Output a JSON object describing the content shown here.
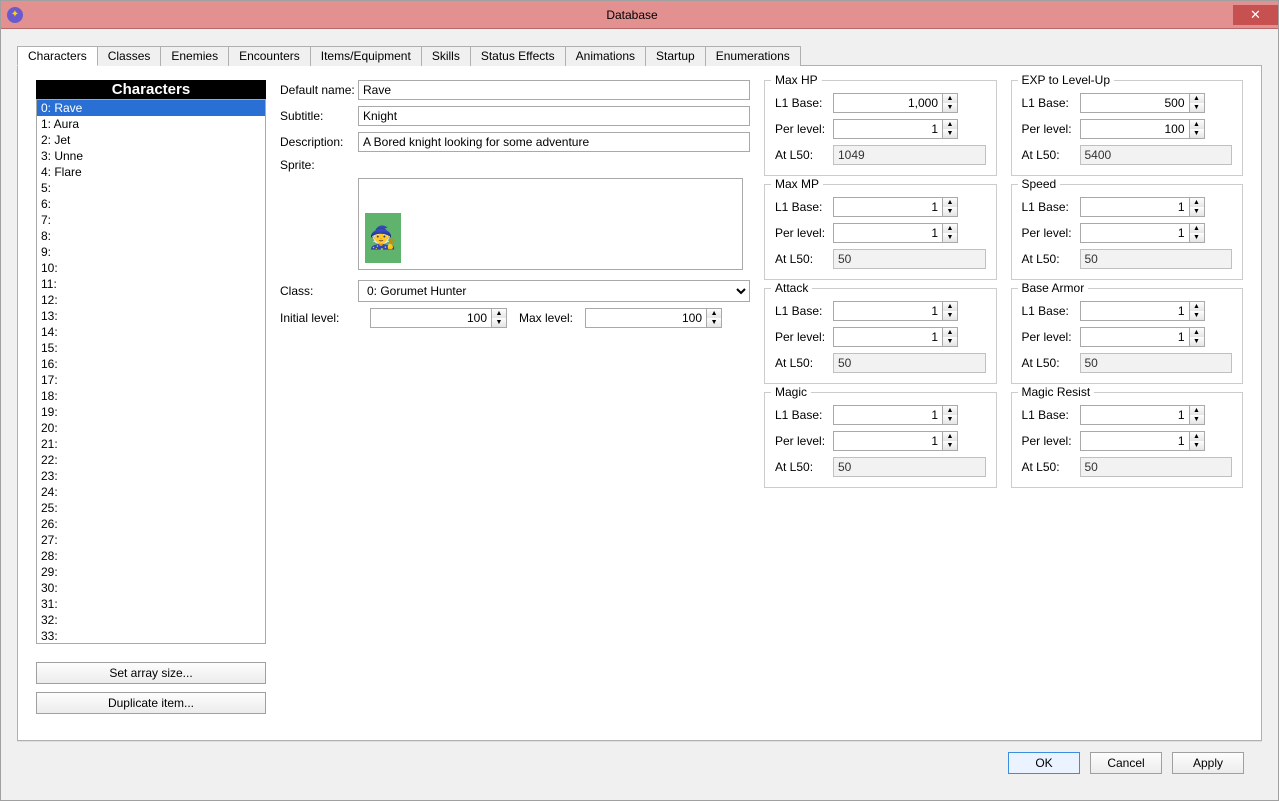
{
  "window": {
    "title": "Database"
  },
  "tabs": [
    "Characters",
    "Classes",
    "Enemies",
    "Encounters",
    "Items/Equipment",
    "Skills",
    "Status Effects",
    "Animations",
    "Startup",
    "Enumerations"
  ],
  "active_tab": 0,
  "char_list_header": "Characters",
  "char_list": [
    "0: Rave",
    "1: Aura",
    "2: Jet",
    "3: Unne",
    "4: Flare",
    "5:",
    "6:",
    "7:",
    "8:",
    "9:",
    "10:",
    "11:",
    "12:",
    "13:",
    "14:",
    "15:",
    "16:",
    "17:",
    "18:",
    "19:",
    "20:",
    "21:",
    "22:",
    "23:",
    "24:",
    "25:",
    "26:",
    "27:",
    "28:",
    "29:",
    "30:",
    "31:",
    "32:",
    "33:"
  ],
  "selected_char_index": 0,
  "left_buttons": {
    "set_array": "Set array size...",
    "duplicate": "Duplicate item..."
  },
  "labels": {
    "default_name": "Default name:",
    "subtitle": "Subtitle:",
    "description": "Description:",
    "sprite": "Sprite:",
    "class": "Class:",
    "initial_level": "Initial level:",
    "max_level": "Max level:",
    "l1base": "L1 Base:",
    "perlevel": "Per level:",
    "atl50": "At L50:"
  },
  "fields": {
    "default_name": "Rave",
    "subtitle": "Knight",
    "description": "A Bored knight looking for some adventure",
    "class_selected": "0: Gorumet Hunter",
    "initial_level": "100",
    "max_level": "100"
  },
  "stats": {
    "left": [
      {
        "title": "Max HP",
        "l1base": "1,000",
        "perlevel": "1",
        "atl50": "1049"
      },
      {
        "title": "Max MP",
        "l1base": "1",
        "perlevel": "1",
        "atl50": "50"
      },
      {
        "title": "Attack",
        "l1base": "1",
        "perlevel": "1",
        "atl50": "50"
      },
      {
        "title": "Magic",
        "l1base": "1",
        "perlevel": "1",
        "atl50": "50"
      }
    ],
    "right": [
      {
        "title": "EXP to Level-Up",
        "l1base": "500",
        "perlevel": "100",
        "atl50": "5400"
      },
      {
        "title": "Speed",
        "l1base": "1",
        "perlevel": "1",
        "atl50": "50"
      },
      {
        "title": "Base Armor",
        "l1base": "1",
        "perlevel": "1",
        "atl50": "50"
      },
      {
        "title": "Magic Resist",
        "l1base": "1",
        "perlevel": "1",
        "atl50": "50"
      }
    ]
  },
  "footer": {
    "ok": "OK",
    "cancel": "Cancel",
    "apply": "Apply"
  }
}
